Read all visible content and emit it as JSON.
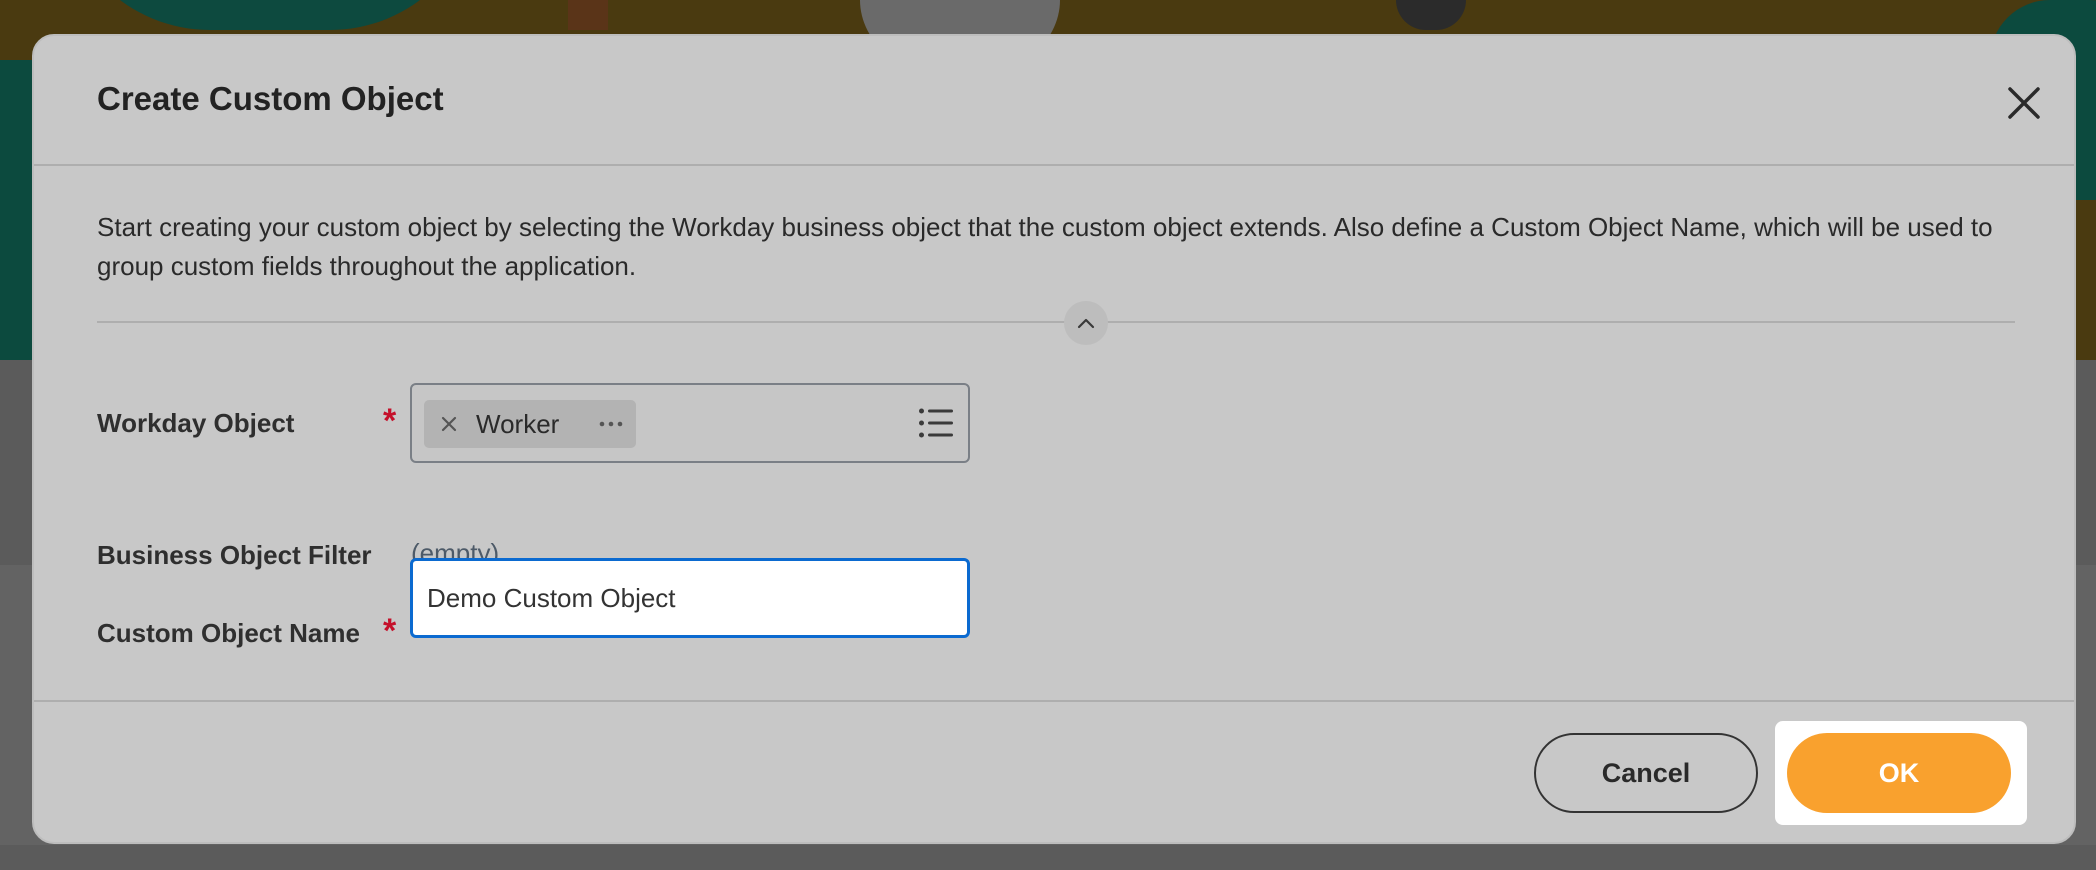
{
  "dialog": {
    "title": "Create Custom Object",
    "description": "Start creating your custom object by selecting the Workday business object that the custom object extends.  Also define a Custom Object Name, which will be used to group custom fields throughout the application."
  },
  "fields": {
    "workday_object": {
      "label": "Workday Object",
      "required_marker": "*",
      "selected_value": "Worker"
    },
    "business_object_filter": {
      "label": "Business Object Filter",
      "value": "(empty)"
    },
    "custom_object_name": {
      "label": "Custom Object Name",
      "required_marker": "*",
      "value": "Demo Custom Object"
    }
  },
  "buttons": {
    "cancel": "Cancel",
    "ok": "OK"
  },
  "colors": {
    "required": "#c5102a",
    "primary_button": "#f9a12e",
    "input_focus": "#0b6ad0"
  },
  "icons": {
    "close": "close-icon",
    "collapse": "chevron-up-icon",
    "remove_selection": "x-icon",
    "more": "ellipsis-icon",
    "prompt_list": "list-icon"
  }
}
